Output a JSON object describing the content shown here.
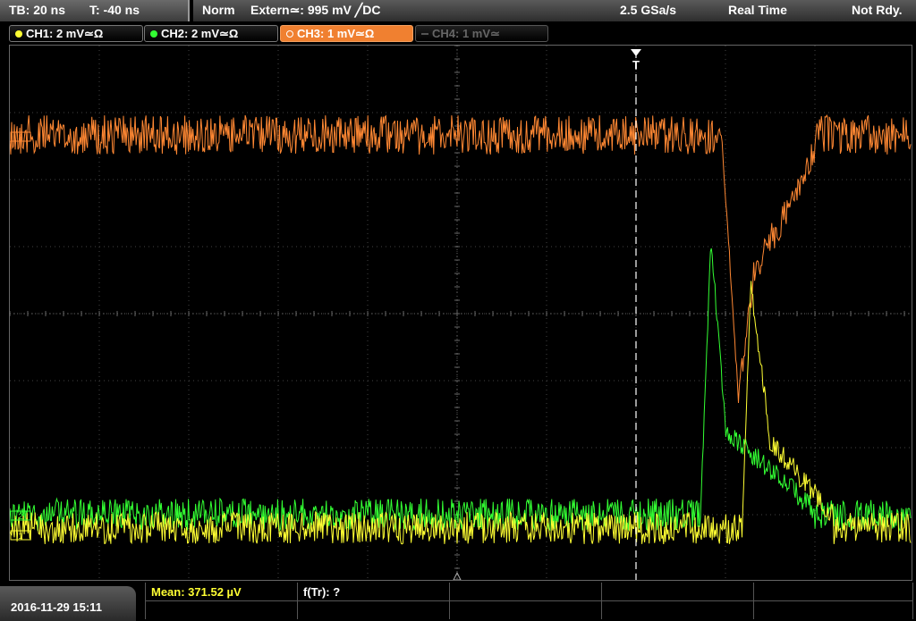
{
  "timebase": {
    "tb": "TB: 20 ns",
    "t": "T: -40 ns"
  },
  "status": {
    "mode": "Norm",
    "trigger": "Extern≃: 995 mV ╱DC",
    "sample_rate": "2.5 GSa/s",
    "acq": "Real Time",
    "ready": "Not Rdy."
  },
  "channels": [
    {
      "label": "CH1: 2 mV≃Ω",
      "color": "#ffff33",
      "state": "on"
    },
    {
      "label": "CH2: 2 mV≃Ω",
      "color": "#33ff33",
      "state": "on"
    },
    {
      "label": "CH3: 1 mV≃Ω",
      "color": "#ff8833",
      "state": "active"
    },
    {
      "label": "CH4: 1 mV≃",
      "color": "#666666",
      "state": "off"
    }
  ],
  "markers": {
    "trigger": "T",
    "ch1": "1",
    "ch2": "2",
    "ch3": "3"
  },
  "measurements": {
    "mean": "Mean: 371.52 µV",
    "freq": "f(Tr): ?"
  },
  "datetime": "2016-11-29 15:11",
  "colors": {
    "ch1": "#ffff33",
    "ch2": "#33ff33",
    "ch3": "#ff8833",
    "grid": "#555555"
  }
}
